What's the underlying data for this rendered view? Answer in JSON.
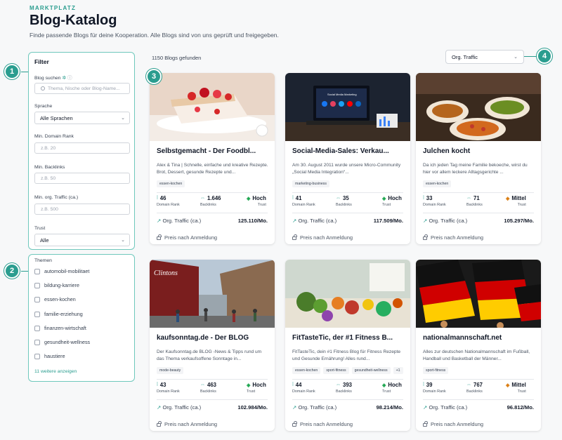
{
  "header": {
    "eyebrow": "MARKTPLATZ",
    "title": "Blog-Katalog",
    "subtitle": "Finde passende Blogs für deine Kooperation. Alle Blogs sind von uns geprüft und freigegeben."
  },
  "callouts": [
    "1",
    "2",
    "3",
    "4"
  ],
  "filter": {
    "title": "Filter",
    "search_label": "Blog suchen",
    "search_placeholder": "Thema, Nische oder Blog-Name...",
    "language_label": "Sprache",
    "language_value": "Alle Sprachen",
    "domain_rank_label": "Min. Domain Rank",
    "domain_rank_placeholder": "z.B. 20",
    "backlinks_label": "Min. Backlinks",
    "backlinks_placeholder": "z.B. 50",
    "traffic_label": "Min. org. Traffic (ca.)",
    "traffic_placeholder": "z.B. 500",
    "trust_label": "Trust",
    "trust_value": "Alle"
  },
  "themen": {
    "title": "Themen",
    "items": [
      "automobil-mobilitaet",
      "bildung-karriere",
      "essen-kochen",
      "familie-erziehung",
      "finanzen-wirtschaft",
      "gesundheit-wellness",
      "haustiere"
    ],
    "more": "11 weitere anzeigen"
  },
  "results": {
    "count": "1150 Blogs gefunden",
    "sort_value": "Org. Traffic"
  },
  "labels": {
    "domain_rank": "Domain Rank",
    "backlinks": "Backlinks",
    "trust": "Trust",
    "traffic": "Org. Traffic (ca.)",
    "preis": "Preis nach Anmeldung"
  },
  "cards": [
    {
      "title": "Selbstgemacht - Der Foodbl...",
      "desc": "Alex & Tina | Schnelle, einfache und kreative Rezepte. Brot, Dessert, gesunde Rezepte und...",
      "tags": [
        "essen-kochen"
      ],
      "dr": "46",
      "backlinks": "1.646",
      "trust": "Hoch",
      "traffic": "125.110/Mo."
    },
    {
      "title": "Social-Media-Sales: Verkau...",
      "desc": "Am 30. August 2011 wurde unsere Micro-Community „Social Media Integration“...",
      "tags": [
        "marketing-business"
      ],
      "dr": "41",
      "backlinks": "35",
      "trust": "Hoch",
      "traffic": "117.509/Mo."
    },
    {
      "title": "Julchen kocht",
      "desc": "Da ich jeden Tag meine Familie bekoeche, wirst du hier vor allem leckere Alltagsgerichte ...",
      "tags": [
        "essen-kochen"
      ],
      "dr": "33",
      "backlinks": "71",
      "trust": "Mittel",
      "traffic": "105.297/Mo."
    },
    {
      "title": "kaufsonntag.de - Der BLOG",
      "desc": "Der Kaufsonntag.de BLOG -News & Tipps rund um das Thema verkaufsoffene Sonntage in...",
      "tags": [
        "mode-beauty"
      ],
      "dr": "43",
      "backlinks": "463",
      "trust": "Hoch",
      "traffic": "102.984/Mo."
    },
    {
      "title": "FitTasteTic, der #1 Fitness B...",
      "desc": "FitTasteTic, dein #1 Fitness Blog für Fitness Rezepte und Gesunde Ernährung! Alles rund...",
      "tags": [
        "essen-kochen",
        "sport-fitness",
        "gesundheit-wellness",
        "+1"
      ],
      "dr": "44",
      "backlinks": "393",
      "trust": "Hoch",
      "traffic": "98.214/Mo."
    },
    {
      "title": "nationalmannschaft.net",
      "desc": "Alles zur deutschen Nationalmannschaft im Fußball, Handball und Basketball der Männer...",
      "tags": [
        "sport-fitness"
      ],
      "dr": "39",
      "backlinks": "767",
      "trust": "Mittel",
      "traffic": "96.812/Mo."
    }
  ],
  "colors": {
    "accent": "#2a9d8f",
    "trust_hoch": "#16a34a",
    "trust_mittel": "#d97706"
  }
}
